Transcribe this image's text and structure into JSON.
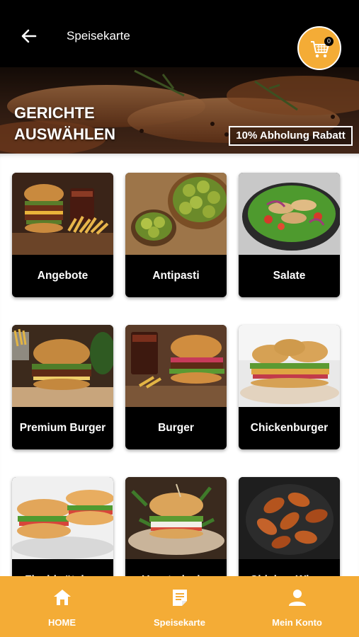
{
  "header": {
    "title": "Speisekarte",
    "cart_count": "0"
  },
  "banner": {
    "heading_line1": "GERICHTE",
    "heading_line2": "AUSWÄHLEN",
    "discount": "10% Abholung Rabatt"
  },
  "categories": [
    {
      "label": "Angebote",
      "icon": "burger-fries-image"
    },
    {
      "label": "Antipasti",
      "icon": "olives-image"
    },
    {
      "label": "Salate",
      "icon": "salad-image"
    },
    {
      "label": "Premium Burger",
      "icon": "premium-burger-image"
    },
    {
      "label": "Burger",
      "icon": "burger-image"
    },
    {
      "label": "Chickenburger",
      "icon": "chickenburger-image"
    },
    {
      "label": "Fischbrötchen",
      "icon": "bagel-image"
    },
    {
      "label": "Vegetarische",
      "icon": "veggie-burger-image"
    },
    {
      "label": "Chicken Wings",
      "icon": "chicken-wings-image"
    }
  ],
  "bottom_nav": {
    "items": [
      {
        "label": "HOME",
        "icon": "home-icon"
      },
      {
        "label": "Speisekarte",
        "icon": "menu-icon"
      },
      {
        "label": "Mein Konto",
        "icon": "user-icon"
      }
    ]
  },
  "colors": {
    "accent": "#f4ac36",
    "header_bg": "#000000",
    "card_label_bg": "#000000"
  }
}
